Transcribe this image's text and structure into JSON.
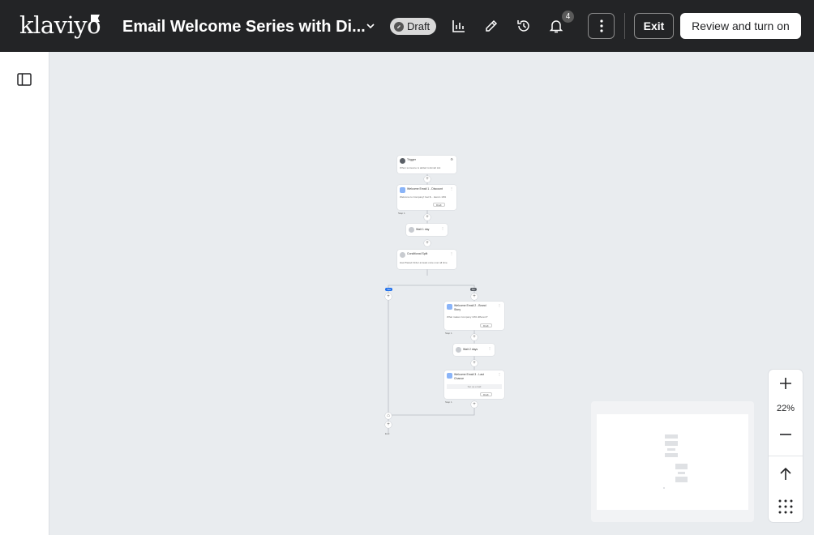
{
  "header": {
    "logo_text": "klaviyo",
    "flow_title": "Email Welcome Series with Di...",
    "status_label": "Draft",
    "notification_count": "4",
    "exit_label": "Exit",
    "review_label": "Review and turn on",
    "icons": [
      "chevron-down-icon",
      "analytics-icon",
      "edit-pencil-icon",
      "history-icon",
      "bell-icon",
      "more-vertical-icon"
    ]
  },
  "sidebar": {
    "toggle_icon": "sidebar-toggle-icon"
  },
  "flow": {
    "trigger": {
      "title": "Trigger",
      "subtitle": "When someone is added to Email List"
    },
    "email_1": {
      "title": "Welcome Email 1 - Discount",
      "subtitle": "Welcome to Company! Get $... Here's 10%",
      "status": "Draft",
      "step": "Step 1"
    },
    "wait_1": {
      "title": "Wait 1 day"
    },
    "split": {
      "title": "Conditional Split",
      "subtitle": "Has Placed Order at least once over all time"
    },
    "branch_yes": "Yes",
    "branch_no": "No",
    "email_2": {
      "title": "Welcome Email 2 - Brand Story",
      "subtitle": "What makes Company 10% different?",
      "status": "Draft",
      "step": "Step 1"
    },
    "wait_2": {
      "title": "Wait 2 days"
    },
    "email_3": {
      "title": "Welcome Email 3 - Last Chance",
      "setup": "Set up email",
      "status": "Draft",
      "step": "Step 1"
    },
    "end_label": "End"
  },
  "zoom": {
    "level": "22%",
    "zoom_in_icon": "plus-icon",
    "zoom_out_icon": "minus-icon",
    "fit_icon": "arrow-up-icon",
    "grid_icon": "grid-dots-icon"
  },
  "colors": {
    "header_bg": "#232426",
    "canvas_bg": "#e9ecef",
    "branch_yes": "#1f6feb",
    "branch_no": "#5a5f66"
  }
}
